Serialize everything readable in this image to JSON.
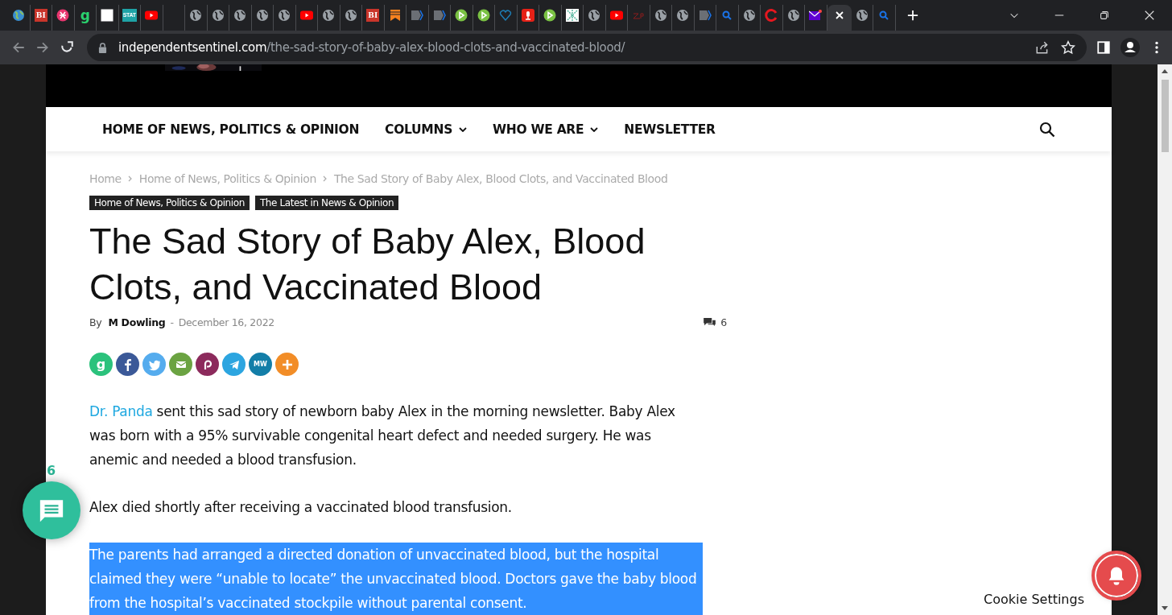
{
  "browser": {
    "tabs": [
      {
        "kind": "earth",
        "selected": false
      },
      {
        "kind": "letters",
        "label": "BI",
        "selected": false
      },
      {
        "kind": "pink",
        "selected": false
      },
      {
        "kind": "letters",
        "label": "g",
        "selected": false
      },
      {
        "kind": "square",
        "selected": false
      },
      {
        "kind": "letters",
        "label": "STAT",
        "selected": false
      },
      {
        "kind": "youtube",
        "selected": false
      },
      {
        "kind": "blank",
        "selected": false
      },
      {
        "kind": "globe",
        "selected": false
      },
      {
        "kind": "globe",
        "selected": false
      },
      {
        "kind": "globe",
        "selected": false
      },
      {
        "kind": "globe",
        "selected": false
      },
      {
        "kind": "globe",
        "selected": false
      },
      {
        "kind": "youtube",
        "selected": false
      },
      {
        "kind": "globe",
        "selected": false
      },
      {
        "kind": "globe",
        "selected": false
      },
      {
        "kind": "letters",
        "label": "BI",
        "selected": false
      },
      {
        "kind": "bookmark",
        "selected": false
      },
      {
        "kind": "chevron",
        "selected": false
      },
      {
        "kind": "chevron",
        "selected": false
      },
      {
        "kind": "play",
        "selected": false
      },
      {
        "kind": "play",
        "selected": false
      },
      {
        "kind": "heart",
        "selected": false
      },
      {
        "kind": "mic",
        "selected": false
      },
      {
        "kind": "play",
        "selected": false
      },
      {
        "kind": "pattern",
        "selected": false
      },
      {
        "kind": "globe",
        "selected": false
      },
      {
        "kind": "youtube",
        "selected": false
      },
      {
        "kind": "scribble",
        "selected": false
      },
      {
        "kind": "globe",
        "selected": false
      },
      {
        "kind": "globe",
        "selected": false
      },
      {
        "kind": "chevron",
        "selected": false
      },
      {
        "kind": "search",
        "selected": false
      },
      {
        "kind": "globe",
        "selected": false
      },
      {
        "kind": "ring",
        "selected": false
      },
      {
        "kind": "globe",
        "selected": false
      },
      {
        "kind": "mail",
        "selected": false
      },
      {
        "kind": "close",
        "selected": true
      },
      {
        "kind": "globe",
        "selected": false
      },
      {
        "kind": "search",
        "selected": false
      }
    ],
    "address": {
      "domain": "independentsentinel.com",
      "path": "/the-sad-story-of-baby-alex-blood-clots-and-vaccinated-blood/"
    }
  },
  "nav": [
    {
      "label": "HOME OF NEWS, POLITICS & OPINION",
      "has_menu": false
    },
    {
      "label": "COLUMNS",
      "has_menu": true
    },
    {
      "label": "WHO WE ARE",
      "has_menu": true
    },
    {
      "label": "NEWSLETTER",
      "has_menu": false
    }
  ],
  "breadcrumbs": [
    "Home",
    "Home of News, Politics & Opinion",
    "The Sad Story of Baby Alex, Blood Clots, and Vaccinated Blood"
  ],
  "categories": [
    "Home of News, Politics & Opinion",
    "The Latest in News & Opinion"
  ],
  "title": "The Sad Story of Baby Alex, Blood Clots, and Vaccinated Blood",
  "byline": {
    "by": "By",
    "author": "M Dowling",
    "separator": "-",
    "date": "December 16, 2022",
    "comments": "6"
  },
  "share": [
    {
      "kind": "letter",
      "label": "g",
      "color": "#2bc27c"
    },
    {
      "kind": "facebook",
      "color": "#3b5998"
    },
    {
      "kind": "twitter",
      "color": "#55acee"
    },
    {
      "kind": "email",
      "color": "#6ba342"
    },
    {
      "kind": "patreon",
      "color": "#8c2a5c"
    },
    {
      "kind": "telegram",
      "color": "#2ca5e0"
    },
    {
      "kind": "letter",
      "label": "MW",
      "color": "#137ea8"
    },
    {
      "kind": "plus",
      "color": "#f28d27"
    }
  ],
  "paragraphs": [
    {
      "link": "Dr. Panda",
      "text": " sent this sad story of newborn baby Alex in the morning newsletter. Baby Alex was born with a 95% survivable congenital heart defect and needed surgery. He was anemic and needed a blood transfusion.",
      "selected": false
    },
    {
      "text": "Alex died shortly after receiving a vaccinated blood transfusion.",
      "selected": false
    },
    {
      "text": "The parents had arranged a directed donation of unvaccinated blood, but the hospital claimed they were “unable to locate” the unvaccinated blood. Doctors gave the baby blood from the hospital’s vaccinated stockpile without parental consent.",
      "selected": true
    }
  ],
  "comment_count": "6",
  "cookie_settings": "Cookie Settings"
}
